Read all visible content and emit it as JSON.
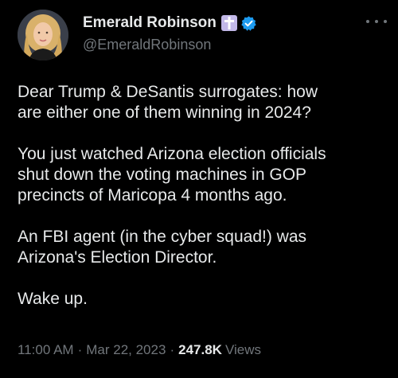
{
  "tweet": {
    "author": {
      "display_name": "Emerald Robinson",
      "handle": "@EmeraldRobinson",
      "badge_icon": "cross-icon",
      "verified_icon": "verified-badge-icon",
      "verified_color": "#1d9bf0"
    },
    "body": {
      "paragraphs": [
        "Dear Trump & DeSantis surrogates: how\nare either one of them winning in 2024?",
        "You just watched Arizona election officials\nshut down the voting machines in GOP\nprecincts of Maricopa 4 months ago.",
        "An FBI agent (in the cyber squad!) was\nArizona's Election Director.",
        "Wake up."
      ]
    },
    "meta": {
      "time": "11:00 AM",
      "separator": "·",
      "date": "Mar 22, 2023",
      "views_count": "247.8K",
      "views_label": "Views"
    },
    "more_icon": "more-horizontal-icon"
  },
  "colors": {
    "background": "#000000",
    "text_primary": "#e7e9ea",
    "text_secondary": "#71767b"
  }
}
